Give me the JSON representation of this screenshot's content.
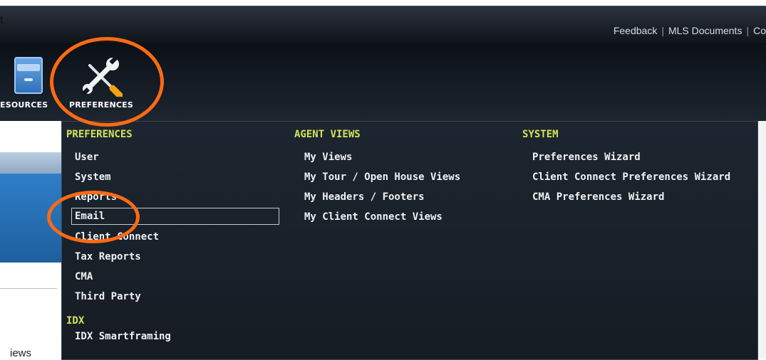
{
  "header": {
    "corner_fragment": "t",
    "links": [
      "Feedback",
      "MLS Documents",
      "Co"
    ]
  },
  "toolbar": {
    "resources_label": "ESOURCES",
    "preferences_label": "PREFERENCES"
  },
  "page": {
    "views_fragment": "iews"
  },
  "dropdown": {
    "columns": [
      {
        "heading": "PREFERENCES",
        "items": [
          "User",
          "System",
          "Reports",
          "Email",
          "Client Connect",
          "Tax Reports",
          "CMA",
          "Third Party"
        ],
        "selected": "Email"
      },
      {
        "heading": "AGENT VIEWS",
        "items": [
          "My Views",
          "My Tour / Open House Views",
          "My Headers / Footers",
          "My Client Connect Views"
        ]
      },
      {
        "heading": "SYSTEM",
        "items": [
          "Preferences Wizard",
          "Client Connect Preferences Wizard",
          "CMA Preferences Wizard"
        ]
      }
    ],
    "idx": {
      "heading": "IDX",
      "items": [
        "IDX Smartframing"
      ]
    }
  },
  "colors": {
    "annotation": "#ff6a13",
    "heading": "#d6e35a",
    "menu_bg": "#1d2630"
  },
  "icons": [
    "resources-icon",
    "wrench-screwdriver-icon"
  ]
}
